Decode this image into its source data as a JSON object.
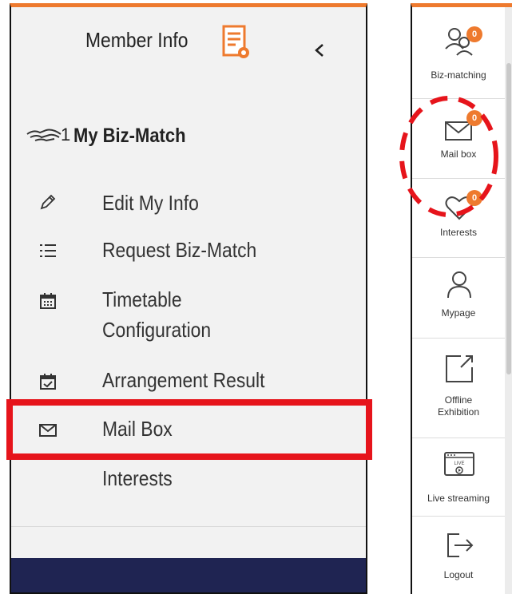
{
  "left_panel": {
    "header": {
      "title": "Member Info"
    },
    "biz_match": {
      "title_number": "1",
      "title": "My Biz-Match"
    },
    "menu": [
      {
        "label": "Edit My Info",
        "icon": "pencil-icon"
      },
      {
        "label": "Request Biz-Match",
        "icon": "list-icon"
      },
      {
        "label": "Timetable",
        "label2": "Configuration",
        "icon": "calendar-icon"
      },
      {
        "label": "Arrangement Result",
        "icon": "calendar-check-icon"
      },
      {
        "label": "Mail Box",
        "icon": "envelope-icon"
      },
      {
        "label": "Interests",
        "icon": "none"
      }
    ]
  },
  "right_sidebar": {
    "items": [
      {
        "label": "Biz-matching",
        "badge": "0",
        "icon": "people-icon"
      },
      {
        "label": "Mail box",
        "badge": "0",
        "icon": "envelope-icon"
      },
      {
        "label": "Interests",
        "badge": "0",
        "icon": "heart-icon"
      },
      {
        "label": "Mypage",
        "icon": "user-icon"
      },
      {
        "label": "Offline",
        "label2": "Exhibition",
        "icon": "external-link-icon"
      },
      {
        "label": "Live streaming",
        "icon": "live-icon"
      },
      {
        "label": "Logout",
        "icon": "logout-icon"
      }
    ]
  },
  "colors": {
    "accent": "#ee7a2e",
    "highlight": "#e6141b",
    "footer": "#1f2452"
  }
}
